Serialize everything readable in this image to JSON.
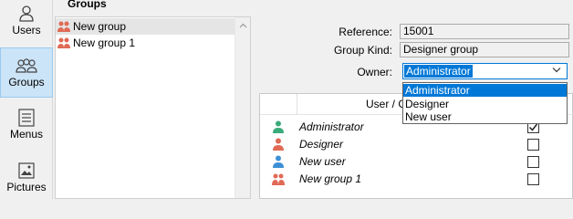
{
  "nav": {
    "items": [
      {
        "label": "Users",
        "icon": "user-icon"
      },
      {
        "label": "Groups",
        "icon": "group-icon"
      },
      {
        "label": "Menus",
        "icon": "menu-icon"
      },
      {
        "label": "Pictures",
        "icon": "picture-icon"
      }
    ]
  },
  "groups": {
    "title": "Groups",
    "items": [
      {
        "label": "New group",
        "selected": true
      },
      {
        "label": "New group 1",
        "selected": false
      }
    ]
  },
  "form": {
    "reference_label": "Reference:",
    "reference_value": "15001",
    "kind_label": "Group Kind:",
    "kind_value": "Designer group",
    "owner_label": "Owner:",
    "owner_value": "Administrator"
  },
  "owner_dropdown": {
    "options": [
      {
        "label": "Administrator",
        "selected": true
      },
      {
        "label": "Designer",
        "selected": false
      },
      {
        "label": "New user",
        "selected": false
      }
    ]
  },
  "members": {
    "header": "User / G",
    "rows": [
      {
        "name": "Administrator",
        "icon": "user-icon",
        "color": "#3aaa7a",
        "checked": true
      },
      {
        "name": "Designer",
        "icon": "user-icon",
        "color": "#e06a55",
        "checked": false
      },
      {
        "name": "New user",
        "icon": "user-icon",
        "color": "#3d8fd6",
        "checked": false
      },
      {
        "name": "New group 1",
        "icon": "group-icon",
        "color": "#e06a55",
        "checked": false
      }
    ]
  },
  "colors": {
    "accent": "#0078d7",
    "nav_active": "#cce4f7",
    "group_icon": "#e06a55"
  }
}
